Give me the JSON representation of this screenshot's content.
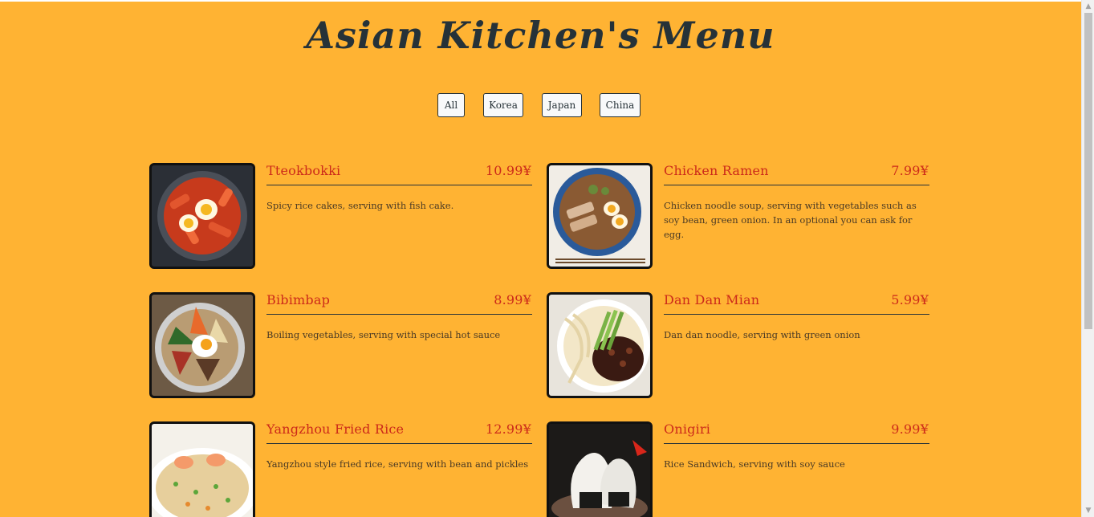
{
  "page": {
    "title": "Asian Kitchen's Menu"
  },
  "filters": [
    {
      "label": "All"
    },
    {
      "label": "Korea"
    },
    {
      "label": "Japan"
    },
    {
      "label": "China"
    }
  ],
  "menu": [
    {
      "name": "Tteokbokki",
      "price": "10.99¥",
      "description": "Spicy rice cakes, serving with fish cake.",
      "photo": "tteokbokki-photo"
    },
    {
      "name": "Chicken Ramen",
      "price": "7.99¥",
      "description": "Chicken noodle soup, serving with vegetables such as soy bean, green onion. In an optional you can ask for egg.",
      "photo": "chicken-ramen-photo"
    },
    {
      "name": "Bibimbap",
      "price": "8.99¥",
      "description": "Boiling vegetables, serving with special hot sauce",
      "photo": "bibimbap-photo"
    },
    {
      "name": "Dan Dan Mian",
      "price": "5.99¥",
      "description": "Dan dan noodle, serving with green onion",
      "photo": "dan-dan-mian-photo"
    },
    {
      "name": "Yangzhou Fried Rice",
      "price": "12.99¥",
      "description": "Yangzhou style fried rice, serving with bean and pickles",
      "photo": "yangzhou-fried-rice-photo"
    },
    {
      "name": "Onigiri",
      "price": "9.99¥",
      "description": "Rice Sandwich, serving with soy sauce",
      "photo": "onigiri-photo"
    }
  ],
  "colors": {
    "background": "#ffb333",
    "accent": "#cc2a1a",
    "text": "#263238"
  }
}
